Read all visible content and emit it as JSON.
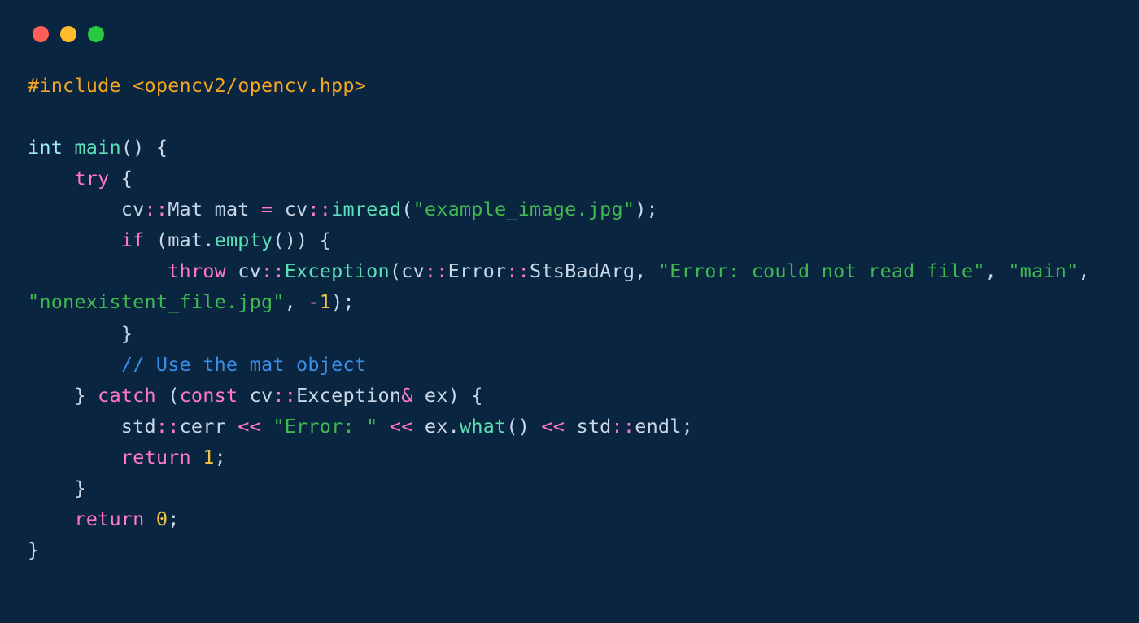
{
  "traffic_lights": [
    "red",
    "yellow",
    "green"
  ],
  "tokens": [
    {
      "t": "#include <opencv2/opencv.hpp>",
      "c": "preproc"
    },
    {
      "t": "\n",
      "c": "default"
    },
    {
      "t": "\n",
      "c": "default"
    },
    {
      "t": "int",
      "c": "type"
    },
    {
      "t": " ",
      "c": "default"
    },
    {
      "t": "main",
      "c": "fn"
    },
    {
      "t": "() {",
      "c": "punc"
    },
    {
      "t": "\n",
      "c": "default"
    },
    {
      "t": "    ",
      "c": "default"
    },
    {
      "t": "try",
      "c": "key"
    },
    {
      "t": " {",
      "c": "punc"
    },
    {
      "t": "\n",
      "c": "default"
    },
    {
      "t": "        cv",
      "c": "ns"
    },
    {
      "t": "::",
      "c": "key"
    },
    {
      "t": "Mat mat ",
      "c": "default"
    },
    {
      "t": "=",
      "c": "key"
    },
    {
      "t": " cv",
      "c": "ns"
    },
    {
      "t": "::",
      "c": "key"
    },
    {
      "t": "imread",
      "c": "fn"
    },
    {
      "t": "(",
      "c": "punc"
    },
    {
      "t": "\"example_image.jpg\"",
      "c": "str"
    },
    {
      "t": ");",
      "c": "punc"
    },
    {
      "t": "\n",
      "c": "default"
    },
    {
      "t": "        ",
      "c": "default"
    },
    {
      "t": "if",
      "c": "key"
    },
    {
      "t": " (mat.",
      "c": "default"
    },
    {
      "t": "empty",
      "c": "fn"
    },
    {
      "t": "()) {",
      "c": "punc"
    },
    {
      "t": "\n",
      "c": "default"
    },
    {
      "t": "            ",
      "c": "default"
    },
    {
      "t": "throw",
      "c": "key"
    },
    {
      "t": " cv",
      "c": "ns"
    },
    {
      "t": "::",
      "c": "key"
    },
    {
      "t": "Exception",
      "c": "fn"
    },
    {
      "t": "(cv",
      "c": "punc"
    },
    {
      "t": "::",
      "c": "key"
    },
    {
      "t": "Error",
      "c": "default"
    },
    {
      "t": "::",
      "c": "key"
    },
    {
      "t": "StsBadArg, ",
      "c": "default"
    },
    {
      "t": "\"Error: could not read file\"",
      "c": "str"
    },
    {
      "t": ", ",
      "c": "punc"
    },
    {
      "t": "\"main\"",
      "c": "str"
    },
    {
      "t": ", ",
      "c": "punc"
    },
    {
      "t": "\"nonexistent_file.jpg\"",
      "c": "str"
    },
    {
      "t": ", ",
      "c": "punc"
    },
    {
      "t": "-",
      "c": "key"
    },
    {
      "t": "1",
      "c": "num"
    },
    {
      "t": ");",
      "c": "punc"
    },
    {
      "t": "\n",
      "c": "default"
    },
    {
      "t": "        }",
      "c": "punc"
    },
    {
      "t": "\n",
      "c": "default"
    },
    {
      "t": "        ",
      "c": "default"
    },
    {
      "t": "// Use the mat object",
      "c": "comment"
    },
    {
      "t": "\n",
      "c": "default"
    },
    {
      "t": "    } ",
      "c": "punc"
    },
    {
      "t": "catch",
      "c": "key"
    },
    {
      "t": " (",
      "c": "punc"
    },
    {
      "t": "const",
      "c": "key"
    },
    {
      "t": " cv",
      "c": "ns"
    },
    {
      "t": "::",
      "c": "key"
    },
    {
      "t": "Exception",
      "c": "default"
    },
    {
      "t": "&",
      "c": "key"
    },
    {
      "t": " ex) {",
      "c": "punc"
    },
    {
      "t": "\n",
      "c": "default"
    },
    {
      "t": "        std",
      "c": "ns"
    },
    {
      "t": "::",
      "c": "key"
    },
    {
      "t": "cerr ",
      "c": "default"
    },
    {
      "t": "<<",
      "c": "key"
    },
    {
      "t": " ",
      "c": "default"
    },
    {
      "t": "\"Error: \"",
      "c": "str"
    },
    {
      "t": " ",
      "c": "default"
    },
    {
      "t": "<<",
      "c": "key"
    },
    {
      "t": " ex.",
      "c": "default"
    },
    {
      "t": "what",
      "c": "fn"
    },
    {
      "t": "() ",
      "c": "punc"
    },
    {
      "t": "<<",
      "c": "key"
    },
    {
      "t": " std",
      "c": "ns"
    },
    {
      "t": "::",
      "c": "key"
    },
    {
      "t": "endl;",
      "c": "default"
    },
    {
      "t": "\n",
      "c": "default"
    },
    {
      "t": "        ",
      "c": "default"
    },
    {
      "t": "return",
      "c": "key"
    },
    {
      "t": " ",
      "c": "default"
    },
    {
      "t": "1",
      "c": "num"
    },
    {
      "t": ";",
      "c": "punc"
    },
    {
      "t": "\n",
      "c": "default"
    },
    {
      "t": "    }",
      "c": "punc"
    },
    {
      "t": "\n",
      "c": "default"
    },
    {
      "t": "    ",
      "c": "default"
    },
    {
      "t": "return",
      "c": "key"
    },
    {
      "t": " ",
      "c": "default"
    },
    {
      "t": "0",
      "c": "num"
    },
    {
      "t": ";",
      "c": "punc"
    },
    {
      "t": "\n",
      "c": "default"
    },
    {
      "t": "}",
      "c": "punc"
    }
  ]
}
